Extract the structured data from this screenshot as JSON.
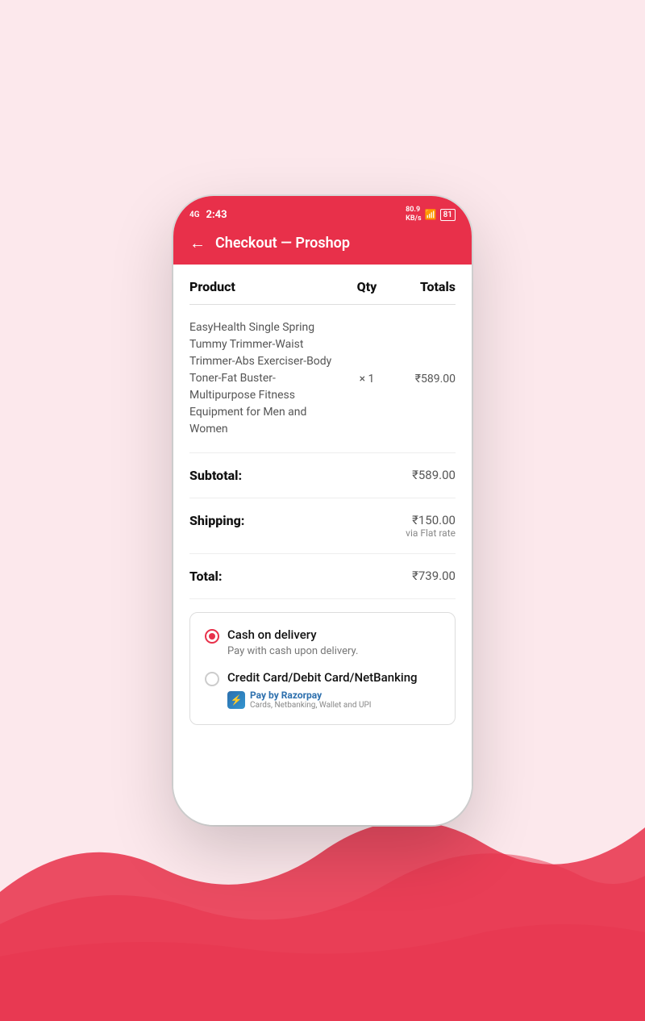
{
  "background": {
    "color": "#fce8ec"
  },
  "status_bar": {
    "time": "2:43",
    "signal": "4G",
    "battery": "81",
    "wifi": "on"
  },
  "header": {
    "back_label": "←",
    "title": "Checkout — Proshop"
  },
  "table": {
    "col_product": "Product",
    "col_qty": "Qty",
    "col_totals": "Totals"
  },
  "product": {
    "name": "EasyHealth Single Spring Tummy Trimmer-Waist Trimmer-Abs Exerciser-Body Toner-Fat Buster-Multipurpose Fitness Equipment for Men and Women",
    "qty": "× 1",
    "price": "₹589.00"
  },
  "summary": {
    "subtotal_label": "Subtotal:",
    "subtotal_value": "₹589.00",
    "shipping_label": "Shipping:",
    "shipping_value": "₹150.00",
    "shipping_via": "via Flat rate",
    "total_label": "Total:",
    "total_value": "₹739.00"
  },
  "payment_options": [
    {
      "id": "cod",
      "name": "Cash on delivery",
      "description": "Pay with cash upon delivery.",
      "selected": true
    },
    {
      "id": "card",
      "name": "Credit Card/Debit Card/NetBanking",
      "description": "",
      "selected": false,
      "badge": {
        "name": "Pay by Razorpay",
        "sub": "Cards, Netbanking, Wallet and UPI"
      }
    }
  ]
}
